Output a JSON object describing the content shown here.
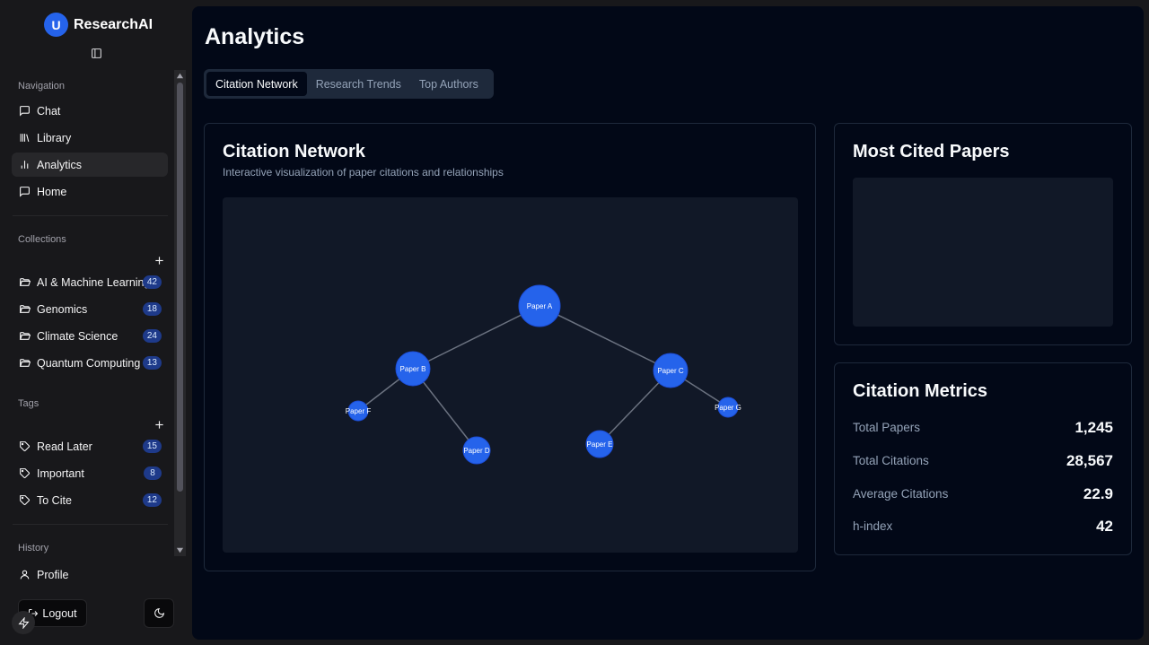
{
  "brand": {
    "avatar_letter": "U",
    "name": "ResearchAI"
  },
  "sidebar": {
    "navigation_label": "Navigation",
    "nav_items": [
      {
        "label": "Chat",
        "icon": "message-square-icon",
        "active": false
      },
      {
        "label": "Library",
        "icon": "library-icon",
        "active": false
      },
      {
        "label": "Analytics",
        "icon": "bar-chart-icon",
        "active": true
      },
      {
        "label": "Home",
        "icon": "message-square-icon",
        "active": false
      }
    ],
    "collections_label": "Collections",
    "collections": [
      {
        "label": "AI & Machine Learning",
        "count": "42",
        "icon": "folder-open-icon"
      },
      {
        "label": "Genomics",
        "count": "18",
        "icon": "folder-open-icon"
      },
      {
        "label": "Climate Science",
        "count": "24",
        "icon": "folder-open-icon"
      },
      {
        "label": "Quantum Computing",
        "count": "13",
        "icon": "folder-open-icon"
      }
    ],
    "tags_label": "Tags",
    "tags": [
      {
        "label": "Read Later",
        "count": "15",
        "icon": "tag-icon"
      },
      {
        "label": "Important",
        "count": "8",
        "icon": "tag-icon"
      },
      {
        "label": "To Cite",
        "count": "12",
        "icon": "tag-icon"
      }
    ],
    "history_label": "History",
    "profile_label": "Profile",
    "logout_label": "Logout"
  },
  "main": {
    "title": "Analytics",
    "tabs": [
      {
        "label": "Citation Network",
        "active": true
      },
      {
        "label": "Research Trends",
        "active": false
      },
      {
        "label": "Top Authors",
        "active": false
      }
    ],
    "network_card": {
      "title": "Citation Network",
      "subtitle": "Interactive visualization of paper citations and relationships",
      "nodes": [
        {
          "id": "A",
          "label": "Paper A"
        },
        {
          "id": "B",
          "label": "Paper B"
        },
        {
          "id": "C",
          "label": "Paper C"
        },
        {
          "id": "D",
          "label": "Paper D"
        },
        {
          "id": "E",
          "label": "Paper E"
        },
        {
          "id": "F",
          "label": "Paper F"
        },
        {
          "id": "G",
          "label": "Paper G"
        }
      ],
      "edges": [
        [
          "A",
          "B"
        ],
        [
          "A",
          "C"
        ],
        [
          "B",
          "F"
        ],
        [
          "B",
          "D"
        ],
        [
          "C",
          "E"
        ],
        [
          "C",
          "G"
        ]
      ],
      "node_color": "#2563eb",
      "edge_color": "#6b7280"
    },
    "cited_card": {
      "title": "Most Cited Papers"
    },
    "metrics_card": {
      "title": "Citation Metrics",
      "metrics": [
        {
          "label": "Total Papers",
          "value": "1,245"
        },
        {
          "label": "Total Citations",
          "value": "28,567"
        },
        {
          "label": "Average Citations",
          "value": "22.9"
        },
        {
          "label": "h-index",
          "value": "42"
        }
      ]
    }
  }
}
